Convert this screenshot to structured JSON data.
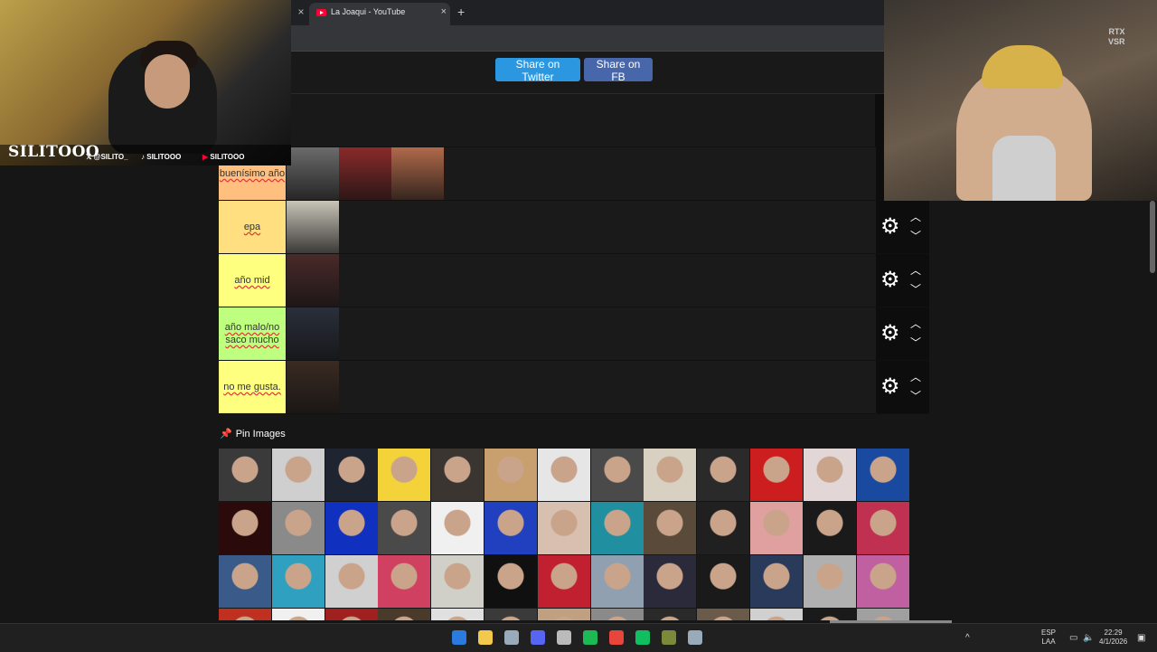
{
  "browser": {
    "tab_title": "La Joaqui - YouTube",
    "close_glyph": "×",
    "new_tab_glyph": "+"
  },
  "share": {
    "twitter_label": "Share on Twitter",
    "fb_label": "Share on FB"
  },
  "tiers": [
    {
      "label": "buenísimo año",
      "color": "#ffbf7f",
      "thumbs": [
        "#6b6b6b",
        "#8a2a2a",
        "#b06a4a"
      ]
    },
    {
      "label": "epa",
      "color": "#ffdf7f",
      "thumbs": [
        "#c8c4b8"
      ]
    },
    {
      "label": "año mid",
      "color": "#ffff7f",
      "thumbs": [
        "#4a2a2a"
      ]
    },
    {
      "label": "año malo/no saco mucho",
      "color": "#bfff7f",
      "thumbs": [
        "#2a2f3a"
      ]
    },
    {
      "label": "no me gusta.",
      "color": "#ffff7f",
      "thumbs": [
        "#3a2a22"
      ]
    }
  ],
  "pin_images": {
    "title": "Pin Images",
    "colors": [
      "#3a3a3a",
      "#cfcfcf",
      "#1e2430",
      "#f4d23a",
      "#3a3530",
      "#c8a070",
      "#e6e6e6",
      "#4a4a4a",
      "#d8d0c0",
      "#2a2a2a",
      "#cc1e1e",
      "#e2d6d6",
      "#1a4aa0",
      "#2a0a0a",
      "#8a8a8a",
      "#1030c0",
      "#4a4a4a",
      "#f0f0f0",
      "#2040c0",
      "#d8c0b0",
      "#2090a0",
      "#5a4a3a",
      "#202020",
      "#e0a0a0",
      "#1a1a1a",
      "#c03050",
      "#3a5a8a",
      "#30a0c0",
      "#d0d0d0",
      "#d04060",
      "#d0d0c8",
      "#101010",
      "#c02030",
      "#90a0b0",
      "#2a2a3a",
      "#1a1a1a",
      "#2a3a5a",
      "#b0b0b0",
      "#c060a0",
      "#c03020",
      "#f0f0f0",
      "#a02020",
      "#4a3a2a",
      "#e0e0e0",
      "#3a3a3a",
      "#c0a080",
      "#8a8a8a",
      "#2a2a2a",
      "#6a5a4a",
      "#d0d0d0",
      "#1a1a1a",
      "#a0a0a0"
    ]
  },
  "webcam_left": {
    "logo": "SILITOOO",
    "x_handle": "@SILITO_",
    "tiktok_handle": "SILITOOO",
    "youtube_handle": "SILITOOO"
  },
  "webcam_right": {
    "rtx_line1": "RTX",
    "rtx_line2": "VSR"
  },
  "taskbar": {
    "lang_line1": "ESP",
    "lang_line2": "LAA",
    "time": "22:29",
    "date": "4/1/2026",
    "app_colors": [
      "#2a7adf",
      "#f2c94c",
      "#9ab",
      "#5865f2",
      "#bbb",
      "#1db954",
      "#e8453c",
      "#10c060",
      "#7a8a3a",
      "#9ab"
    ]
  }
}
